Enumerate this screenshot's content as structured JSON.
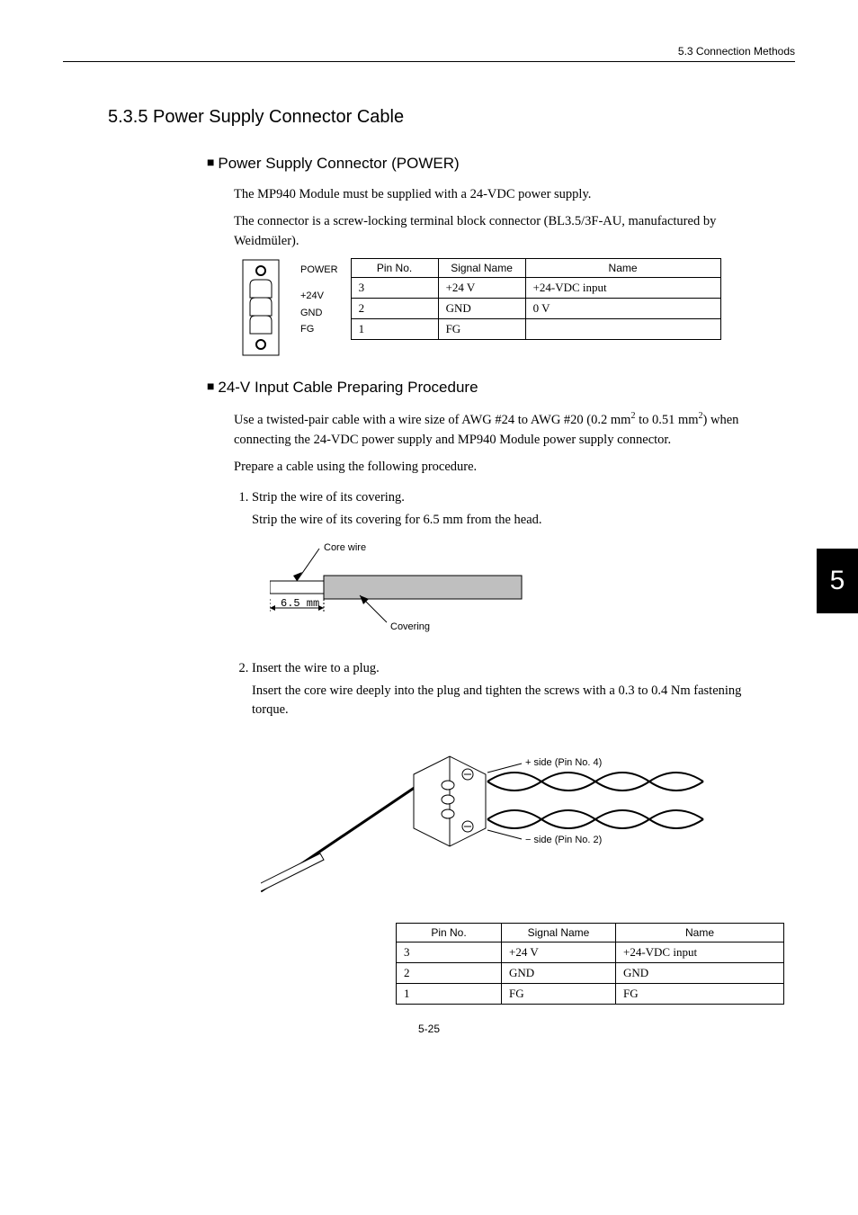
{
  "header": {
    "breadcrumb": "5.3  Connection Methods"
  },
  "section": {
    "title": "5.3.5  Power Supply Connector Cable"
  },
  "sub1": {
    "title": "Power Supply Connector (POWER)",
    "p1": "The MP940 Module must be supplied with a 24-VDC power supply.",
    "p2": "The connector is a screw-locking terminal block connector (BL3.5/3F-AU, manufactured by Weidmüler)."
  },
  "connector_labels": {
    "title": "POWER",
    "l1": "+24V",
    "l2": "GND",
    "l3": "FG"
  },
  "table1": {
    "headers": {
      "pin": "Pin No.",
      "signal": "Signal Name",
      "name": "Name"
    },
    "rows": [
      {
        "pin": "3",
        "signal": "+24 V",
        "name": "+24-VDC input"
      },
      {
        "pin": "2",
        "signal": "GND",
        "name": "0 V"
      },
      {
        "pin": "1",
        "signal": "FG",
        "name": ""
      }
    ]
  },
  "sub2": {
    "title": "24-V Input Cable Preparing Procedure",
    "p1_a": "Use a twisted-pair cable with a wire size of AWG #24 to AWG #20 (0.2 mm",
    "p1_b": " to 0.51 mm",
    "p1_c": ") when connecting the 24-VDC power supply and MP940 Module power supply connector.",
    "p2": "Prepare a cable using the following procedure.",
    "step1_title": "Strip the wire of its covering.",
    "step1_body": "Strip the wire of its covering for 6.5 mm from the head.",
    "fig1": {
      "core": "Core wire",
      "covering": "Covering",
      "dim": "6.5 mm"
    },
    "step2_title": "Insert the wire to a plug.",
    "step2_body": "Insert the core wire deeply into the plug and tighten the screws with a 0.3 to 0.4 Nm fastening torque.",
    "fig2": {
      "plus": "+ side (Pin No. 4)",
      "minus": "− side (Pin No. 2)"
    }
  },
  "table2": {
    "headers": {
      "pin": "Pin No.",
      "signal": "Signal Name",
      "name": "Name"
    },
    "rows": [
      {
        "pin": "3",
        "signal": "+24 V",
        "name": "+24-VDC input"
      },
      {
        "pin": "2",
        "signal": "GND",
        "name": "GND"
      },
      {
        "pin": "1",
        "signal": "FG",
        "name": "FG"
      }
    ]
  },
  "chapter_tab": "5",
  "footer": "5-25"
}
